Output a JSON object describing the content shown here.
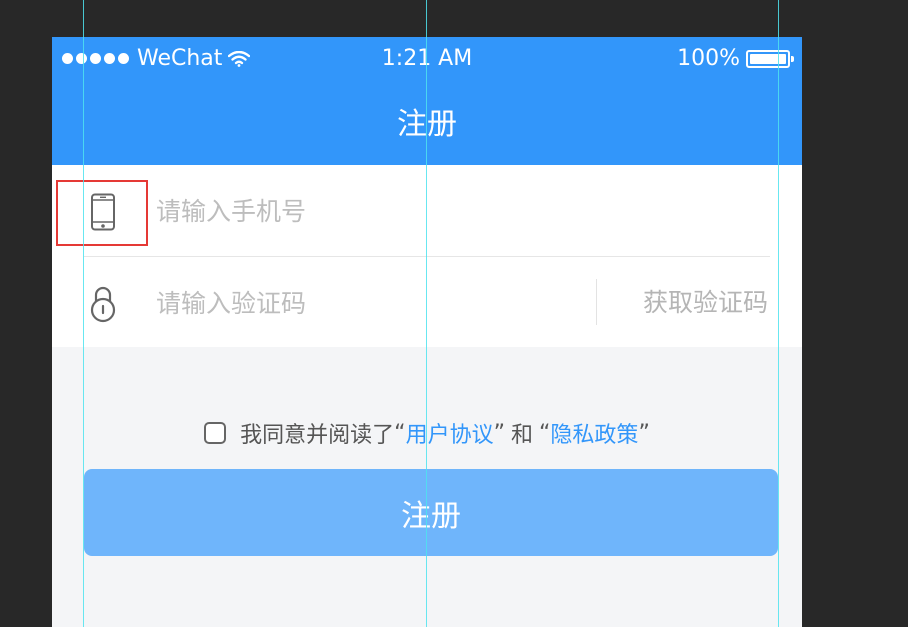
{
  "status_bar": {
    "carrier": "WeChat",
    "time": "1:21 AM",
    "battery": "100%",
    "battery_level": 1.0
  },
  "header": {
    "title": "注册"
  },
  "form": {
    "phone_placeholder": "请输入手机号",
    "code_placeholder": "请输入验证码",
    "get_code_label": "获取验证码"
  },
  "agreement": {
    "prefix": "我同意并阅读了",
    "open_quote": "“",
    "close_quote": "”",
    "link1": "用户协议",
    "conjunction": "和",
    "link2": "隐私政策"
  },
  "submit_label": "注册",
  "icons": {
    "phone": "mobile-phone-icon",
    "lock": "lock-icon",
    "wifi": "wifi-icon",
    "battery": "battery-icon"
  },
  "colors": {
    "primary": "#3296fa",
    "button": "#6fb5fb",
    "highlight_border": "#e53935",
    "guide": "#4de3ee",
    "canvas": "#282828"
  }
}
